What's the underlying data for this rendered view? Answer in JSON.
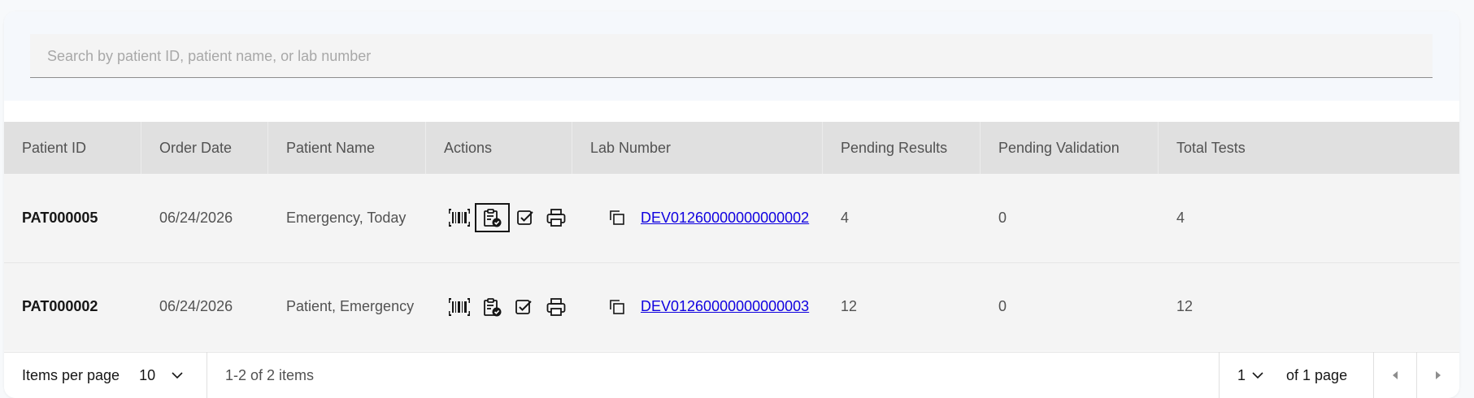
{
  "search": {
    "placeholder": "Search by patient ID, patient name, or lab number"
  },
  "table": {
    "headers": [
      "Patient ID",
      "Order Date",
      "Patient Name",
      "Actions",
      "Lab Number",
      "Pending Results",
      "Pending Validation",
      "Total Tests"
    ],
    "rows": [
      {
        "patient_id": "PAT000005",
        "order_date": "06/24/2026",
        "patient_name": "Emergency, Today",
        "lab_number": "DEV01260000000000002",
        "pending_results": "4",
        "pending_validation": "0",
        "total_tests": "4"
      },
      {
        "patient_id": "PAT000002",
        "order_date": "06/24/2026",
        "patient_name": "Patient, Emergency",
        "lab_number": "DEV01260000000000003",
        "pending_results": "12",
        "pending_validation": "0",
        "total_tests": "12"
      }
    ],
    "action_icons": [
      "barcode-icon",
      "clipboard-check-icon",
      "checkbox-icon",
      "printer-icon"
    ],
    "copy_icon": "copy-icon"
  },
  "pagination": {
    "items_per_page_label": "Items per page",
    "items_per_page_value": "10",
    "range_text": "1-2 of 2 items",
    "page_value": "1",
    "page_of_text": "of 1 page"
  },
  "colors": {
    "header_bg": "#e0e0e0",
    "row_bg": "#f4f4f4",
    "link": "#0f00e0"
  }
}
